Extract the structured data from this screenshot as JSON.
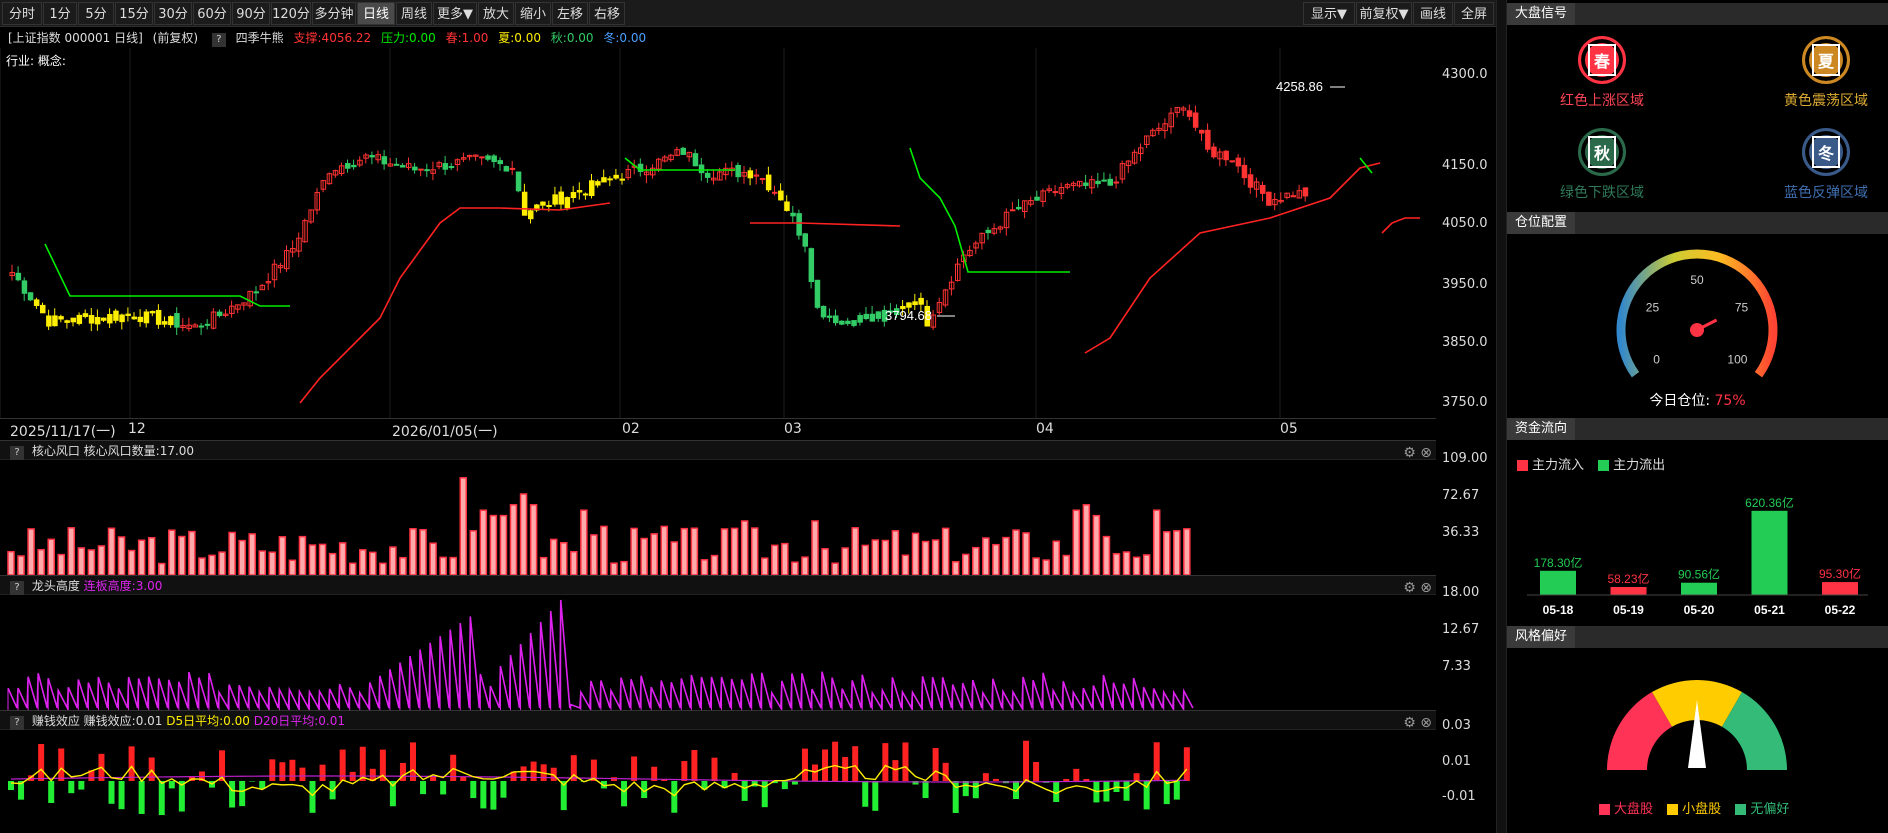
{
  "toolbar": {
    "left": [
      "分时",
      "1分",
      "5分",
      "15分",
      "30分",
      "60分",
      "90分",
      "120分",
      "多分钟",
      "日线",
      "周线",
      "更多▼",
      "放大",
      "缩小",
      "左移",
      "右移"
    ],
    "active": "日线",
    "right": [
      "显示▼",
      "前复权▼",
      "画线",
      "全屏"
    ]
  },
  "header": {
    "title": "[上证指数 000001 日线]",
    "adj": "(前复权)",
    "indicator": "四季牛熊",
    "support": "支撑:4056.22",
    "pressure": "压力:0.00",
    "spring": "春:1.00",
    "summer": "夏:0.00",
    "autumn": "秋:0.00",
    "winter": "冬:0.00"
  },
  "header2": "行业: 概念:",
  "price_axis": [
    "4300.0",
    "4150.0",
    "4050.0",
    "3950.0",
    "3850.0",
    "3750.0"
  ],
  "date_labels": [
    "2025/11/17(一)",
    "12",
    "2026/01/05(一)",
    "02",
    "03",
    "04",
    "05"
  ],
  "annotations": {
    "high": "4258.86",
    "low": "3794.68"
  },
  "panels": {
    "p1": {
      "name": "核心风口",
      "value": "核心风口数量:17.00",
      "axis": [
        "109.00",
        "72.67",
        "36.33"
      ]
    },
    "p2": {
      "name": "龙头高度",
      "value": "连板高度:3.00",
      "axis": [
        "18.00",
        "12.67",
        "7.33"
      ]
    },
    "p3": {
      "name": "赚钱效应",
      "value": "赚钱效应:0.01",
      "d5": "D5日平均:0.00",
      "d20": "D20日平均:0.01",
      "axis": [
        "0.03",
        "0.01",
        "-0.01"
      ]
    }
  },
  "colors": {
    "up": "#ff3333",
    "down": "#33cc66",
    "yellow": "#ffee00",
    "green_line": "#00ee00",
    "magenta": "#dd22ee"
  },
  "right": {
    "signal_title": "大盘信号",
    "signals": [
      {
        "glyph": "春",
        "label": "红色上涨区域",
        "color": "#ff3344"
      },
      {
        "glyph": "夏",
        "label": "黄色震荡区域",
        "color": "#cc8822"
      },
      {
        "glyph": "秋",
        "label": "绿色下跌区域",
        "color": "#2a6a4a"
      },
      {
        "glyph": "冬",
        "label": "蓝色反弹区域",
        "color": "#3a5a8a"
      }
    ],
    "position_title": "仓位配置",
    "gauge_ticks": [
      "0",
      "25",
      "50",
      "75",
      "100"
    ],
    "position_label": "今日仓位:",
    "position_value": "75%",
    "position_fraction": 0.75,
    "flow_title": "资金流向",
    "flow_legend_in": "主力流入",
    "flow_legend_out": "主力流出",
    "style_title": "风格偏好",
    "style_legend": [
      "大盘股",
      "小盘股",
      "无偏好"
    ]
  },
  "chart_data": [
    {
      "type": "bar",
      "id": "capital-flow",
      "categories": [
        "05-18",
        "05-19",
        "05-20",
        "05-21",
        "05-22"
      ],
      "values": [
        178.3,
        58.23,
        90.56,
        620.36,
        95.3
      ],
      "value_labels": [
        "178.30亿",
        "58.23亿",
        "90.56亿",
        "620.36亿",
        "95.30亿"
      ],
      "direction": [
        "out",
        "in",
        "out",
        "out",
        "in"
      ]
    },
    {
      "type": "line",
      "id": "price-annot",
      "high": 4258.86,
      "low": 3794.68,
      "ylim": [
        3720,
        4330
      ]
    }
  ]
}
